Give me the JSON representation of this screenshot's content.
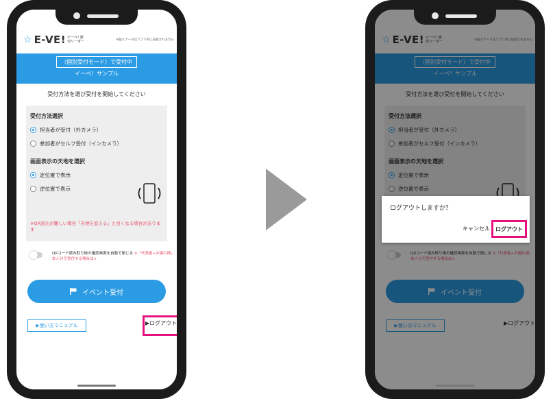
{
  "header": {
    "logo_star": "☆",
    "logo": "E-VE!",
    "logo_sub": "イーベ! 受付リーダー",
    "notice": "※個人データはアプリ内に記録されません"
  },
  "banner": {
    "mode": "（個別受付モード）で受付中",
    "event": "イーベ！サンプル"
  },
  "instruction": "受付方法を選び受付を開始してください",
  "reception": {
    "title": "受付方法選択",
    "options": [
      "担当者が受付（外カメラ）",
      "参加者がセルフ受付（インカメラ）"
    ]
  },
  "orientation": {
    "title": "画面表示の天地を選択",
    "options": [
      "定位置で表示",
      "逆位置で表示"
    ]
  },
  "warning": "※QR読込が難しい場合「天地を変える」と良くなる場合があります",
  "toggle": {
    "text": "QRコード読み取り後の確認画面を自動で閉じる",
    "note": "※「代表者+お連れ様」本人分で受付する場合は×"
  },
  "buttons": {
    "event_reception": "イベント受付",
    "manual": "▶使い方マニュアル",
    "logout": "▶ログアウト"
  },
  "dialog": {
    "title": "ログアウトしますか？",
    "cancel": "キャンセル",
    "confirm": "ログアウト"
  },
  "colors": {
    "accent": "#2b9be4",
    "highlight": "#e4117e",
    "warning": "#e8506a"
  }
}
